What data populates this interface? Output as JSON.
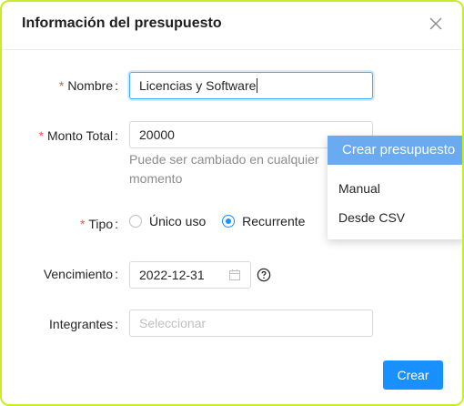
{
  "dialog": {
    "title": "Información del presupuesto",
    "fields": {
      "nombre": {
        "label": "Nombre",
        "value": "Licencias y Software",
        "required": true
      },
      "monto": {
        "label": "Monto Total",
        "value": "20000",
        "hint": "Puede ser cambiado en cualquier momento",
        "required": true
      },
      "tipo": {
        "label": "Tipo",
        "required": true,
        "options": [
          "Único uso",
          "Recurrente"
        ],
        "selected": "Recurrente"
      },
      "vencimiento": {
        "label": "Vencimiento",
        "value": "2022-12-31"
      },
      "integrantes": {
        "label": "Integrantes",
        "placeholder": "Seleccionar"
      }
    },
    "submit_label": "Crear"
  },
  "dropdown": {
    "header": "Crear presupuesto",
    "items": [
      "Manual",
      "Desde CSV"
    ]
  },
  "symbols": {
    "required": "*",
    "colon": ":"
  },
  "colors": {
    "primary": "#1890ff",
    "dropdown_header": "#6aaaf0",
    "required": "#ff4d4f",
    "frame_border": "#c8ec2a"
  }
}
